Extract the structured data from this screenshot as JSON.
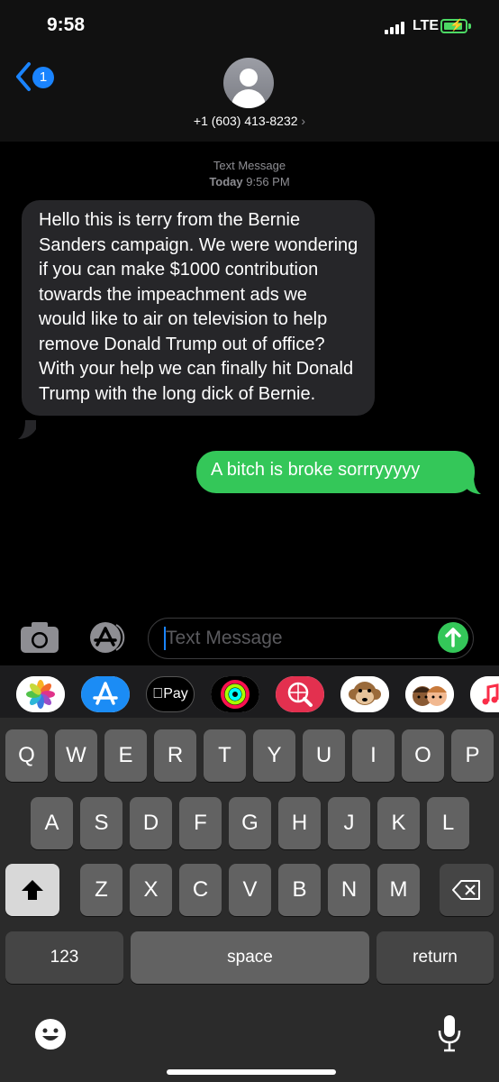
{
  "status_bar": {
    "time": "9:58",
    "network": "LTE"
  },
  "header": {
    "back_badge": "1",
    "contact": "+1 (603) 413-8232",
    "chevron": "›"
  },
  "conversation": {
    "service": "Text Message",
    "date_label": "Today",
    "time": "9:56 PM",
    "messages": [
      {
        "direction": "incoming",
        "text": "Hello this is terry from the Bernie Sanders campaign. We were wondering if you can make $1000 contribution towards the impeachment ads we would like to air on television to help remove Donald Trump out of office? With your help we can finally hit Donald Trump with the long dick of Bernie."
      },
      {
        "direction": "outgoing",
        "text": "A bitch is broke sorrryyyyy"
      }
    ]
  },
  "input": {
    "placeholder": "Text Message"
  },
  "app_drawer": {
    "apple_pay_label": "Pay"
  },
  "keyboard": {
    "row1": [
      "Q",
      "W",
      "E",
      "R",
      "T",
      "Y",
      "U",
      "I",
      "O",
      "P"
    ],
    "row2": [
      "A",
      "S",
      "D",
      "F",
      "G",
      "H",
      "J",
      "K",
      "L"
    ],
    "row3": [
      "Z",
      "X",
      "C",
      "V",
      "B",
      "N",
      "M"
    ],
    "numbers_label": "123",
    "space_label": "space",
    "return_label": "return"
  },
  "colors": {
    "incoming_bubble": "#262629",
    "outgoing_bubble": "#34c759",
    "accent": "#1a84ff"
  },
  "icons": [
    "back-chevron-icon",
    "camera-icon",
    "app-store-icon",
    "send-arrow-icon",
    "photos-icon",
    "apple-pay-icon",
    "activity-icon",
    "web-search-icon",
    "monkey-memoji-icon",
    "memoji-icon",
    "music-icon",
    "shift-icon",
    "backspace-icon",
    "emoji-icon",
    "microphone-icon"
  ]
}
